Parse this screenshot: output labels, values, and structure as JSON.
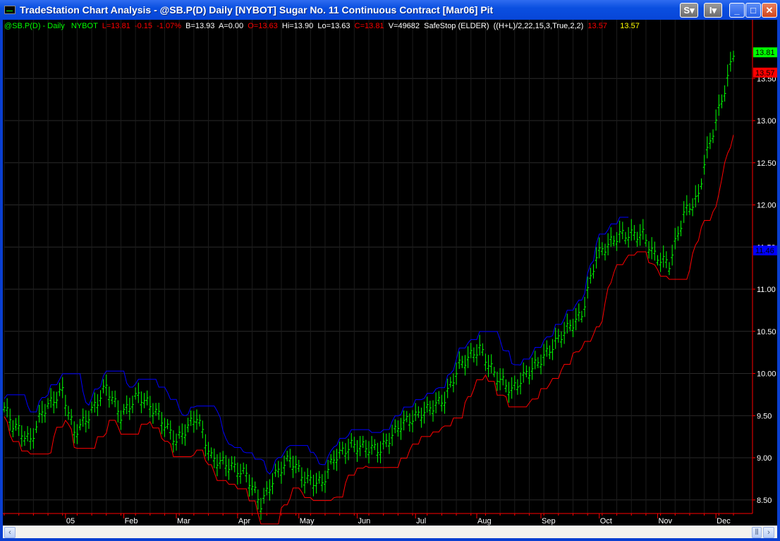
{
  "window": {
    "title": "TradeStation Chart Analysis - @SB.P(D)  Daily  [NYBOT] Sugar No. 11 Continuous Contract [Mar06] Pit",
    "buttons": [
      "S",
      "I"
    ]
  },
  "header": {
    "symbol": "@SB.P(D) - Daily",
    "exchange": "NYBOT",
    "last": "L=13.81",
    "change": "-0.15",
    "pct": "-1.07%",
    "bid": "B=13.93",
    "ask": "A=0.00",
    "open": "O=13.63",
    "high": "Hi=13.90",
    "low": "Lo=13.63",
    "close": "C=13.81",
    "volume": "V=49682",
    "indicator": "SafeStop (ELDER)  ((H+L)/2,22,15,3,True,2,2)",
    "ind_val1": "13.57",
    "ind_val2": "13.57"
  },
  "chart_data": {
    "type": "ohlc",
    "bars": 251,
    "anchors": [
      [
        0,
        9.6
      ],
      [
        3,
        9.4
      ],
      [
        9,
        9.2
      ],
      [
        13,
        9.55
      ],
      [
        20,
        9.8
      ],
      [
        24,
        9.3
      ],
      [
        29,
        9.5
      ],
      [
        35,
        9.85
      ],
      [
        40,
        9.5
      ],
      [
        46,
        9.75
      ],
      [
        52,
        9.55
      ],
      [
        59,
        9.2
      ],
      [
        66,
        9.5
      ],
      [
        71,
        9.0
      ],
      [
        78,
        8.9
      ],
      [
        83,
        8.8
      ],
      [
        88,
        8.45
      ],
      [
        93,
        8.8
      ],
      [
        98,
        9.0
      ],
      [
        103,
        8.75
      ],
      [
        109,
        8.7
      ],
      [
        113,
        9.0
      ],
      [
        119,
        9.15
      ],
      [
        129,
        9.1
      ],
      [
        136,
        9.4
      ],
      [
        144,
        9.55
      ],
      [
        151,
        9.7
      ],
      [
        156,
        10.1
      ],
      [
        163,
        10.3
      ],
      [
        168,
        10.0
      ],
      [
        174,
        9.8
      ],
      [
        179,
        10.0
      ],
      [
        185,
        10.2
      ],
      [
        192,
        10.5
      ],
      [
        198,
        10.7
      ],
      [
        203,
        11.4
      ],
      [
        206,
        11.5
      ],
      [
        211,
        11.65
      ],
      [
        219,
        11.65
      ],
      [
        223,
        11.4
      ],
      [
        228,
        11.3
      ],
      [
        233,
        11.9
      ],
      [
        238,
        12.1
      ],
      [
        240,
        12.5
      ],
      [
        244,
        13.0
      ],
      [
        248,
        13.5
      ],
      [
        250,
        13.81
      ]
    ],
    "yticks": [
      "8.50",
      "9.00",
      "9.50",
      "10.00",
      "10.50",
      "11.00",
      "11.50",
      "12.00",
      "12.50",
      "13.00",
      "13.50"
    ],
    "ylim": [
      8.35,
      14.2
    ],
    "months": [
      {
        "label": "05",
        "bar": 21
      },
      {
        "label": "Feb",
        "bar": 41
      },
      {
        "label": "Mar",
        "bar": 59
      },
      {
        "label": "Apr",
        "bar": 80
      },
      {
        "label": "May",
        "bar": 101
      },
      {
        "label": "Jun",
        "bar": 121
      },
      {
        "label": "Jul",
        "bar": 141
      },
      {
        "label": "Aug",
        "bar": 162
      },
      {
        "label": "Sep",
        "bar": 184
      },
      {
        "label": "Oct",
        "bar": 204
      },
      {
        "label": "Nov",
        "bar": 224
      },
      {
        "label": "Dec",
        "bar": 244
      }
    ],
    "markers": [
      {
        "label": "13.81",
        "value": 13.81,
        "color": "#00ff00"
      },
      {
        "label": "13.57",
        "value": 13.57,
        "color": "#ff0000"
      },
      {
        "label": "11.46",
        "value": 11.46,
        "color": "#0000ff"
      }
    ],
    "colors": {
      "bars": "#00ff00",
      "stop_long": "#ff0000",
      "stop_short": "#0000ff",
      "axis": "#ff0000"
    }
  }
}
